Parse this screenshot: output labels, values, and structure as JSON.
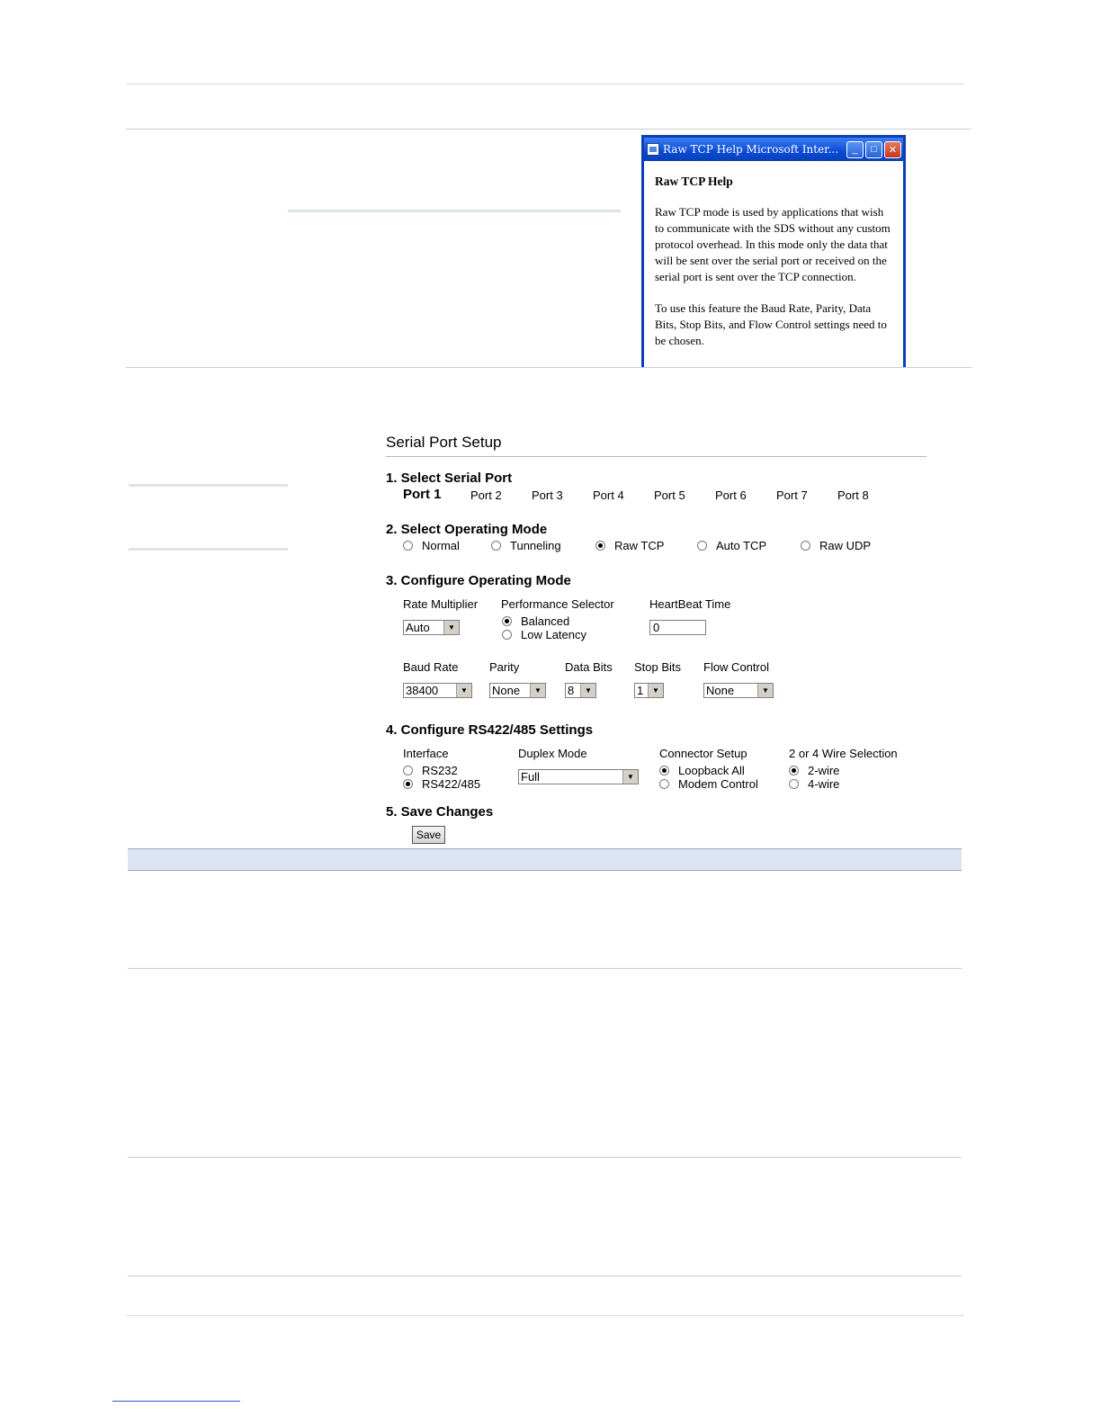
{
  "help_window": {
    "title": "Raw TCP Help  Microsoft Inter...",
    "heading": "Raw TCP Help",
    "paragraphs": [
      "Raw TCP mode is used by applications that wish to communicate with the SDS without any custom protocol overhead.  In this mode only the data that will be sent over the serial port or received on the serial port is sent over the TCP connection.",
      "To use this feature the Baud Rate, Parity, Data Bits, Stop Bits, and Flow Control settings need to be chosen."
    ],
    "buttons": {
      "minimize": "_",
      "maximize": "□",
      "close": "✕"
    }
  },
  "setup": {
    "title": "Serial Port Setup",
    "section1": "1. Select Serial Port",
    "ports": [
      "Port 1",
      "Port 2",
      "Port 3",
      "Port 4",
      "Port 5",
      "Port 6",
      "Port 7",
      "Port 8"
    ],
    "active_port": "Port 1",
    "section2": "2. Select Operating Mode",
    "modes": [
      "Normal",
      "Tunneling",
      "Raw TCP",
      "Auto TCP",
      "Raw UDP"
    ],
    "selected_mode": "Raw TCP",
    "section3": "3. Configure Operating Mode",
    "rate_multiplier": {
      "label": "Rate Multiplier",
      "value": "Auto"
    },
    "performance_selector": {
      "label": "Performance Selector",
      "options": [
        "Balanced",
        "Low Latency"
      ],
      "selected": "Balanced"
    },
    "heartbeat": {
      "label": "HeartBeat Time",
      "value": "0"
    },
    "baud_rate": {
      "label": "Baud Rate",
      "value": "38400"
    },
    "parity": {
      "label": "Parity",
      "value": "None"
    },
    "data_bits": {
      "label": "Data Bits",
      "value": "8"
    },
    "stop_bits": {
      "label": "Stop Bits",
      "value": "1"
    },
    "flow_control": {
      "label": "Flow Control",
      "value": "None"
    },
    "section4": "4. Configure RS422/485 Settings",
    "interface": {
      "label": "Interface",
      "options": [
        "RS232",
        "RS422/485"
      ],
      "selected": "RS422/485"
    },
    "duplex": {
      "label": "Duplex Mode",
      "value": "Full"
    },
    "connector": {
      "label": "Connector Setup",
      "options": [
        "Loopback All",
        "Modem Control"
      ],
      "selected": "Loopback All"
    },
    "wire": {
      "label": "2 or 4 Wire Selection",
      "options": [
        "2-wire",
        "4-wire"
      ],
      "selected": "2-wire"
    },
    "section5": "5. Save Changes",
    "save_label": "Save"
  },
  "icons": {
    "dropdown": "dropdown-arrow-icon",
    "app": "ie-window-icon"
  },
  "colors": {
    "titlebar": "#0a4bd6",
    "band": "#dbe4f1"
  }
}
